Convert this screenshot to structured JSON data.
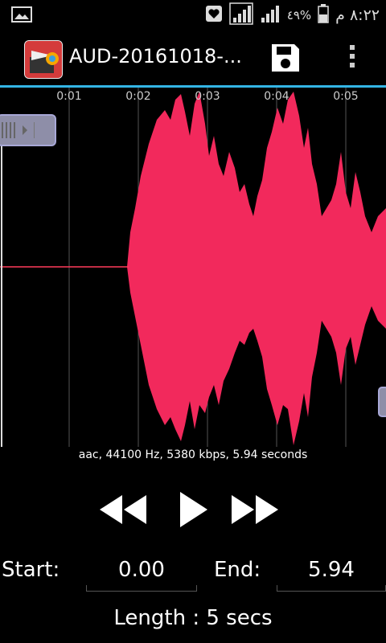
{
  "statusbar": {
    "time": "٨:٢٢ م",
    "battery_pct": "٤٩%",
    "icons": [
      "image-icon",
      "heart-notification-icon",
      "signal-icon",
      "signal-icon",
      "battery-icon"
    ]
  },
  "actionbar": {
    "title": "AUD-20161018-...",
    "save_icon": "save-icon",
    "menu_icon": "overflow-menu-icon"
  },
  "waveform": {
    "timecodes": [
      "0:01",
      "0:02",
      "0:03",
      "0:04",
      "0:05"
    ],
    "color": "#f2295c",
    "start_marker_color": "#ff3a5a"
  },
  "info_line": "aac, 44100 Hz, 5380 kbps, 5.94 seconds",
  "transport": {
    "rewind_icon": "rewind-icon",
    "play_icon": "play-icon",
    "ffwd_icon": "fast-forward-icon"
  },
  "fields": {
    "start_label": "Start:",
    "start_value": "0.00",
    "end_label": "End:",
    "end_value": "5.94"
  },
  "length_text": "Length : 5 secs",
  "colors": {
    "accent": "#33b5e5",
    "wave": "#f2295c",
    "handle": "#8e8ea8"
  }
}
